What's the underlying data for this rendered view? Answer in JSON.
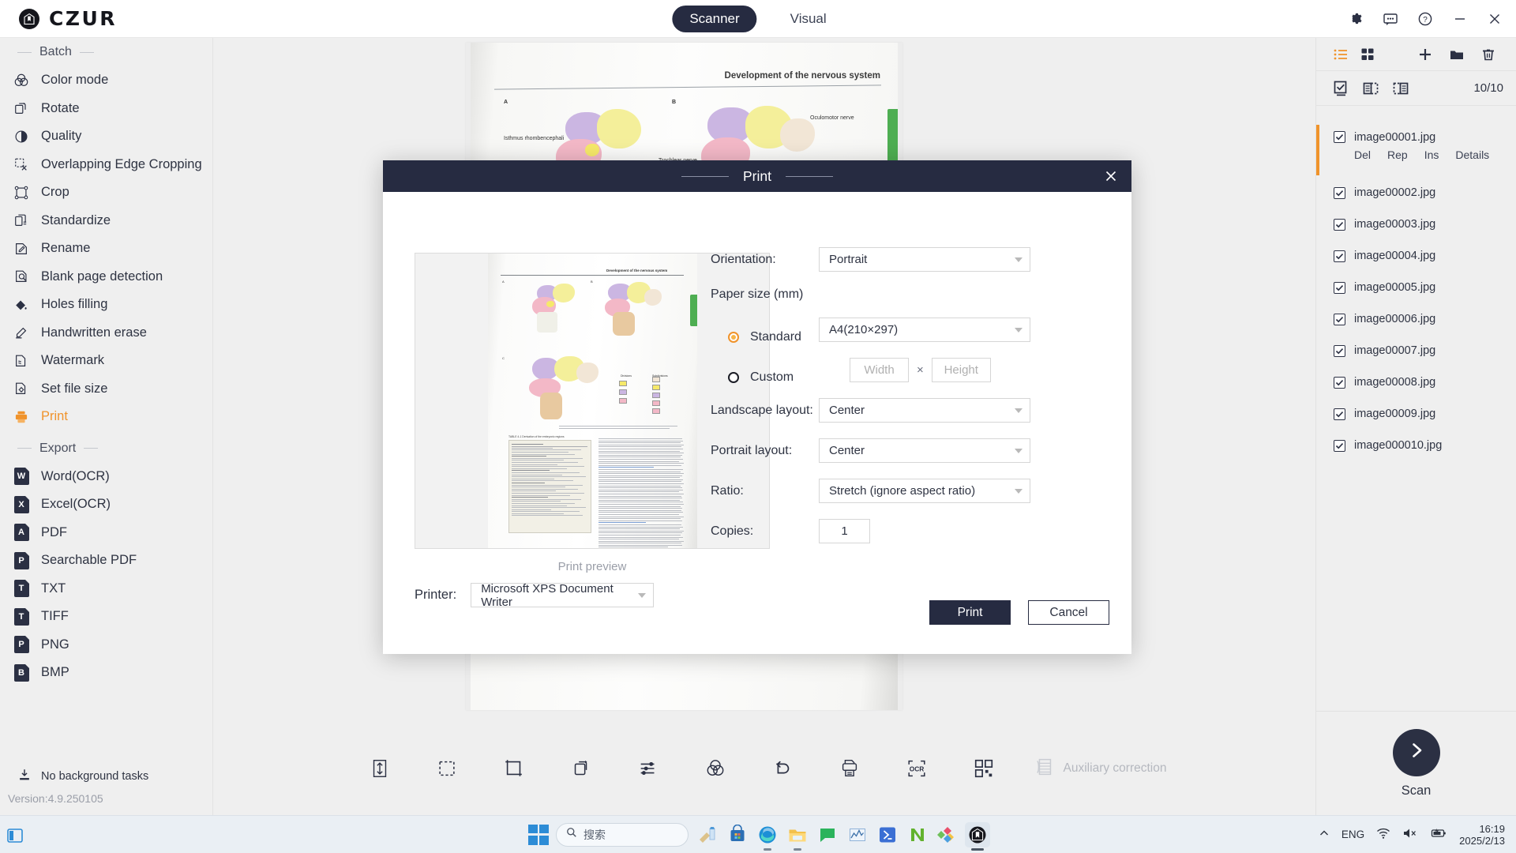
{
  "app": {
    "brand": "CZUR",
    "brand_icon": "czur-logo-icon",
    "tabs": [
      {
        "label": "Scanner",
        "active": true
      },
      {
        "label": "Visual",
        "active": false
      }
    ],
    "window_controls": [
      {
        "name": "settings-icon",
        "label": "Settings"
      },
      {
        "name": "feedback-icon",
        "label": "Feedback"
      },
      {
        "name": "help-icon",
        "label": "Help"
      },
      {
        "name": "minimize-icon",
        "label": "Minimize"
      },
      {
        "name": "close-icon",
        "label": "Close"
      }
    ]
  },
  "sidebar": {
    "group_batch": "Batch",
    "group_export": "Export",
    "batch_items": [
      {
        "label": "Color mode",
        "icon": "color-mode-icon",
        "selected": false
      },
      {
        "label": "Rotate",
        "icon": "rotate-icon",
        "selected": false
      },
      {
        "label": "Quality",
        "icon": "quality-icon",
        "selected": false
      },
      {
        "label": "Overlapping Edge Cropping",
        "icon": "overlap-crop-icon",
        "selected": false
      },
      {
        "label": "Crop",
        "icon": "crop-icon",
        "selected": false
      },
      {
        "label": "Standardize",
        "icon": "standardize-icon",
        "selected": false
      },
      {
        "label": "Rename",
        "icon": "rename-icon",
        "selected": false
      },
      {
        "label": "Blank page detection",
        "icon": "blank-page-detection-icon",
        "selected": false
      },
      {
        "label": "Holes filling",
        "icon": "holes-filling-icon",
        "selected": false
      },
      {
        "label": "Handwritten erase",
        "icon": "handwritten-erase-icon",
        "selected": false
      },
      {
        "label": "Watermark",
        "icon": "watermark-icon",
        "selected": false
      },
      {
        "label": "Set file size",
        "icon": "set-file-size-icon",
        "selected": false
      },
      {
        "label": "Print",
        "icon": "print-icon",
        "selected": true
      }
    ],
    "export_items": [
      {
        "label": "Word(OCR)",
        "badge": "W"
      },
      {
        "label": "Excel(OCR)",
        "badge": "X"
      },
      {
        "label": "PDF",
        "badge": "A"
      },
      {
        "label": "Searchable PDF",
        "badge": "P"
      },
      {
        "label": "TXT",
        "badge": "T"
      },
      {
        "label": "TIFF",
        "badge": "T"
      },
      {
        "label": "PNG",
        "badge": "P"
      },
      {
        "label": "BMP",
        "badge": "B"
      }
    ],
    "background_tasks": "No background tasks",
    "background_tasks_icon": "download-tray-icon",
    "version": "Version:4.9.250105",
    "accent_color": "#f0932b"
  },
  "workspace": {
    "document_header": "Development of the nervous system",
    "document_labels": [
      "A",
      "B",
      "C",
      "Isthmus rhombencephali",
      "Trochlear nerve",
      "Oculomotor nerve"
    ],
    "toolbar": [
      {
        "name": "fit-height-icon",
        "label": "Fit height"
      },
      {
        "name": "select-area-icon",
        "label": "Select area"
      },
      {
        "name": "crop-icon",
        "label": "Crop"
      },
      {
        "name": "rotate-icon",
        "label": "Rotate"
      },
      {
        "name": "adjust-sliders-icon",
        "label": "Adjust"
      },
      {
        "name": "color-mode-icon",
        "label": "Color mode"
      },
      {
        "name": "undo-icon",
        "label": "Undo"
      },
      {
        "name": "print-icon",
        "label": "Print"
      },
      {
        "name": "ocr-icon",
        "label": "OCR"
      },
      {
        "name": "qrcode-icon",
        "label": "QR code"
      }
    ],
    "auxiliary_correction": "Auxiliary correction",
    "auxiliary_correction_icon": "auxiliary-correction-icon"
  },
  "right_panel": {
    "view_icons": [
      {
        "name": "list-view-icon",
        "active": true
      },
      {
        "name": "grid-view-icon",
        "active": false
      }
    ],
    "action_icons": [
      {
        "name": "add-icon"
      },
      {
        "name": "folder-icon"
      },
      {
        "name": "delete-icon"
      }
    ],
    "select_icons": [
      {
        "name": "select-all-icon"
      },
      {
        "name": "select-odd-icon"
      },
      {
        "name": "select-even-icon"
      }
    ],
    "count": "10/10",
    "files": [
      {
        "name": "image00001.jpg",
        "checked": true,
        "selected": true,
        "actions": [
          "Del",
          "Rep",
          "Ins",
          "Details"
        ]
      },
      {
        "name": "image00002.jpg",
        "checked": true,
        "selected": false
      },
      {
        "name": "image00003.jpg",
        "checked": true,
        "selected": false
      },
      {
        "name": "image00004.jpg",
        "checked": true,
        "selected": false
      },
      {
        "name": "image00005.jpg",
        "checked": true,
        "selected": false
      },
      {
        "name": "image00006.jpg",
        "checked": true,
        "selected": false
      },
      {
        "name": "image00007.jpg",
        "checked": true,
        "selected": false
      },
      {
        "name": "image00008.jpg",
        "checked": true,
        "selected": false
      },
      {
        "name": "image00009.jpg",
        "checked": true,
        "selected": false
      },
      {
        "name": "image000010.jpg",
        "checked": true,
        "selected": false
      }
    ],
    "scan_label": "Scan",
    "scan_icon": "chevron-right-icon"
  },
  "print_dialog": {
    "title": "Print",
    "close_icon": "close-icon",
    "preview_caption": "Print preview",
    "printer_label": "Printer:",
    "printer_value": "Microsoft XPS Document Writer",
    "orientation_label": "Orientation:",
    "orientation_value": "Portrait",
    "paper_size_label": "Paper size (mm)",
    "standard_label": "Standard",
    "standard_value": "A4(210×297)",
    "standard_selected": true,
    "custom_label": "Custom",
    "custom_selected": false,
    "custom_width_placeholder": "Width",
    "custom_width_value": "",
    "custom_height_placeholder": "Height",
    "custom_height_value": "",
    "times_symbol": "×",
    "landscape_layout_label": "Landscape layout:",
    "landscape_layout_value": "Center",
    "portrait_layout_label": "Portrait layout:",
    "portrait_layout_value": "Center",
    "ratio_label": "Ratio:",
    "ratio_value": "Stretch (ignore aspect ratio)",
    "copies_label": "Copies:",
    "copies_value": "1",
    "print_button": "Print",
    "cancel_button": "Cancel",
    "header_color": "#262b41",
    "radio_accent": "#f0932b"
  },
  "taskbar": {
    "start_icon": "windows-start-icon",
    "search_placeholder": "搜索",
    "search_icon": "search-icon",
    "apps": [
      {
        "name": "widgets-icon",
        "running": false
      },
      {
        "name": "microsoft-store-icon",
        "running": false
      },
      {
        "name": "edge-browser-icon",
        "running": true
      },
      {
        "name": "file-explorer-icon",
        "running": true
      },
      {
        "name": "chat-icon",
        "running": false
      },
      {
        "name": "stats-app-icon",
        "running": false
      },
      {
        "name": "powershell-icon",
        "running": false
      },
      {
        "name": "nvidia-app-icon",
        "running": false
      },
      {
        "name": "photos-app-icon",
        "running": false
      },
      {
        "name": "czur-app-icon",
        "running": true,
        "active": true
      }
    ],
    "tray": {
      "overflow_icon": "chevron-up-icon",
      "language": "ENG",
      "wifi_icon": "wifi-icon",
      "volume_icon": "volume-muted-icon",
      "battery_icon": "battery-charging-icon",
      "time": "16:19",
      "date": "2025/2/13"
    }
  }
}
